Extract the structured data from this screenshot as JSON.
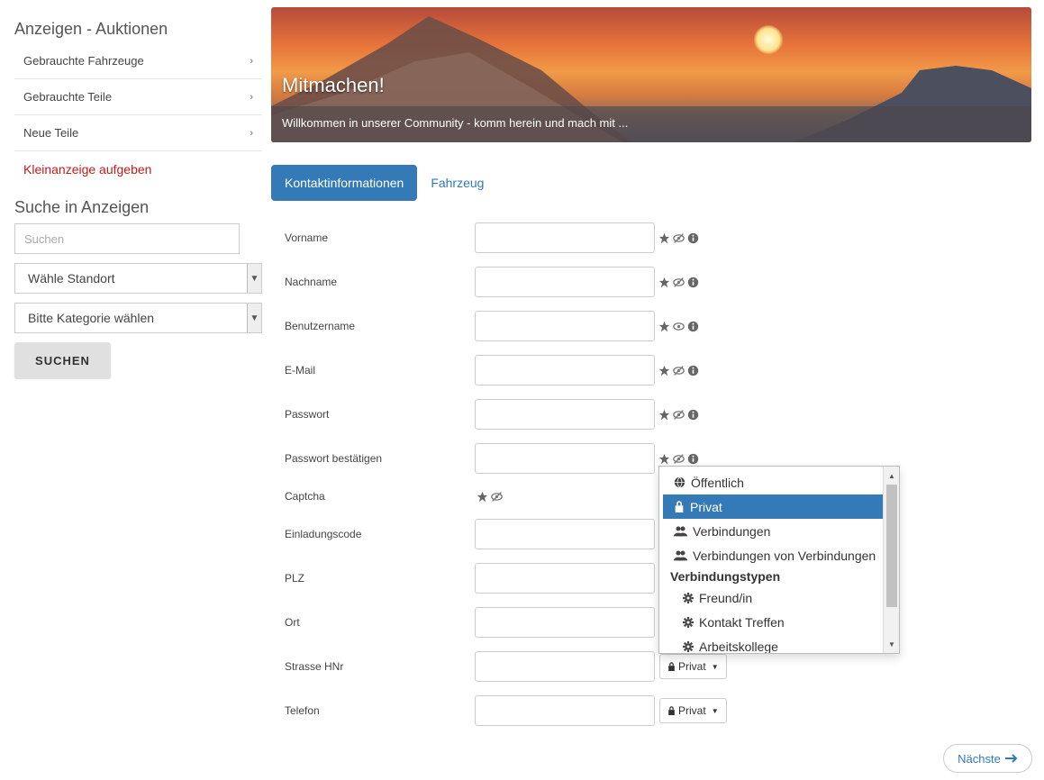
{
  "sidebar": {
    "title": "Anzeigen - Auktionen",
    "items": [
      {
        "label": "Gebrauchte Fahrzeuge"
      },
      {
        "label": "Gebrauchte Teile"
      },
      {
        "label": "Neue Teile"
      }
    ],
    "cta": "Kleinanzeige aufgeben",
    "search_title": "Suche in Anzeigen",
    "search_placeholder": "Suchen",
    "location_select": "Wähle Standort",
    "category_select": "Bitte Kategorie wählen",
    "search_button": "SUCHEN"
  },
  "banner": {
    "title": "Mitmachen!",
    "subtitle": "Willkommen in unserer Community - komm herein und mach mit ..."
  },
  "tabs": [
    {
      "label": "Kontaktinformationen",
      "active": true
    },
    {
      "label": "Fahrzeug",
      "active": false
    }
  ],
  "form": {
    "rows": [
      {
        "label": "Vorname"
      },
      {
        "label": "Nachname"
      },
      {
        "label": "Benutzername"
      },
      {
        "label": "E-Mail"
      },
      {
        "label": "Passwort"
      },
      {
        "label": "Passwort bestätigen"
      },
      {
        "label": "Captcha"
      },
      {
        "label": "Einladungscode"
      },
      {
        "label": "PLZ"
      },
      {
        "label": "Ort"
      },
      {
        "label": "Strasse HNr"
      },
      {
        "label": "Telefon"
      }
    ],
    "privacy_label": "Privat"
  },
  "dropdown": {
    "items": [
      {
        "label": "Öffentlich",
        "icon": "globe-icon"
      },
      {
        "label": "Privat",
        "icon": "lock-icon",
        "active": true
      },
      {
        "label": "Verbindungen",
        "icon": "users-icon"
      },
      {
        "label": "Verbindungen von Verbindungen",
        "icon": "users-icon"
      }
    ],
    "group": "Verbindungstypen",
    "sub_items": [
      {
        "label": "Freund/in",
        "icon": "gear-icon"
      },
      {
        "label": "Kontakt Treffen",
        "icon": "gear-icon"
      },
      {
        "label": "Arbeitskollege",
        "icon": "gear-icon"
      }
    ]
  },
  "next_button": "Nächste",
  "colors": {
    "primary": "#337ab7",
    "cta": "#c41a1a"
  }
}
